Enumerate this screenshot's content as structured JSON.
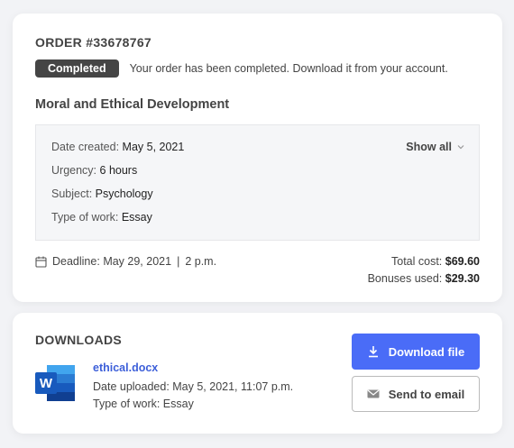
{
  "order": {
    "title": "ORDER #33678767",
    "status_badge": "Completed",
    "status_message": "Your order has been completed. Download it from your account.",
    "topic": "Moral and Ethical Development",
    "details": {
      "date_created_label": "Date created:",
      "date_created_value": "May 5, 2021",
      "urgency_label": "Urgency:",
      "urgency_value": "6 hours",
      "subject_label": "Subject:",
      "subject_value": "Psychology",
      "type_label": "Type of work:",
      "type_value": "Essay",
      "show_all": "Show all"
    },
    "deadline_label": "Deadline:",
    "deadline_date": "May 29, 2021",
    "deadline_time": "2 p.m.",
    "total_cost_label": "Total cost:",
    "total_cost_value": "$69.60",
    "bonuses_label": "Bonuses used:",
    "bonuses_value": "$29.30"
  },
  "downloads": {
    "title": "DOWNLOADS",
    "file_name": "ethical.docx",
    "date_uploaded": "Date uploaded: May 5, 2021, 11:07 p.m.",
    "type_of_work": "Type of work: Essay",
    "download_button": "Download file",
    "email_button": "Send to email",
    "icons": {
      "file": "word-document-icon",
      "download": "download-icon",
      "email": "envelope-icon"
    }
  },
  "colors": {
    "accent": "#4a6cf7",
    "badge": "#454545",
    "link": "#3d5fd9"
  }
}
